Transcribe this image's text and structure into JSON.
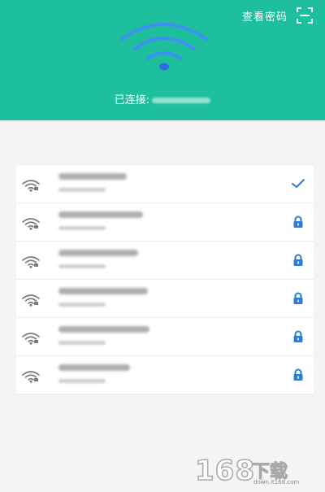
{
  "header": {
    "view_password_label": "查看密码",
    "connected_label": "已连接:",
    "bg_color": "#1dbf9c"
  },
  "icons": {
    "scan": "scan-frame-icon",
    "wifi": "wifi-signal-icon",
    "lock": "lock-icon",
    "check": "checkmark-icon"
  },
  "networks": [
    {
      "status": "connected",
      "ssid_visible": false
    },
    {
      "status": "locked",
      "ssid_visible": false
    },
    {
      "status": "locked",
      "ssid_visible": false
    },
    {
      "status": "locked",
      "ssid_visible": false
    },
    {
      "status": "locked",
      "ssid_visible": false
    },
    {
      "status": "locked",
      "ssid_visible": false
    }
  ],
  "colors": {
    "accent": "#1dbf9c",
    "status_icon": "#2a7fd4",
    "signal_icon": "#7a7a7a"
  },
  "watermark": {
    "number": "168",
    "cn": "下载",
    "url": "down.it168.com"
  }
}
